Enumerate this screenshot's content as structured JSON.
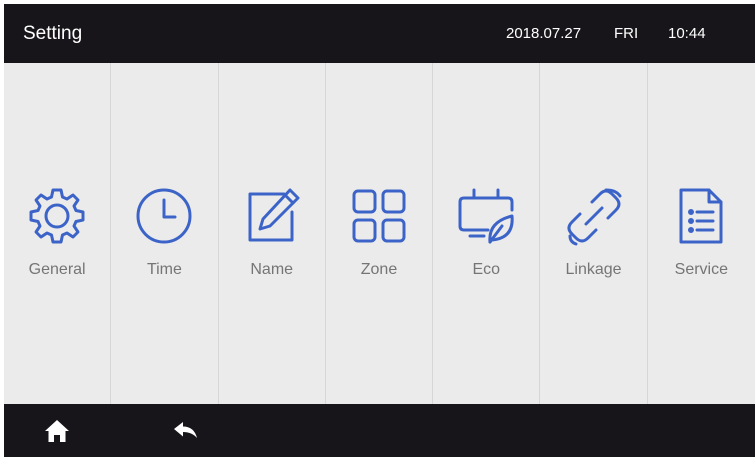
{
  "header": {
    "title": "Setting",
    "date": "2018.07.27",
    "weekday": "FRI",
    "time": "10:44"
  },
  "menu": {
    "items": [
      {
        "label": "General",
        "icon": "gear-icon"
      },
      {
        "label": "Time",
        "icon": "clock-icon"
      },
      {
        "label": "Name",
        "icon": "edit-icon"
      },
      {
        "label": "Zone",
        "icon": "grid-icon"
      },
      {
        "label": "Eco",
        "icon": "eco-leaf-icon"
      },
      {
        "label": "Linkage",
        "icon": "link-icon"
      },
      {
        "label": "Service",
        "icon": "document-list-icon"
      }
    ]
  },
  "footer": {
    "buttons": [
      {
        "icon": "home-icon"
      },
      {
        "icon": "back-arrow-icon"
      }
    ]
  },
  "colors": {
    "bar_background": "#17151a",
    "panel_background": "#ebebeb",
    "icon_blue": "#3c64c8",
    "label_gray": "#757575"
  }
}
